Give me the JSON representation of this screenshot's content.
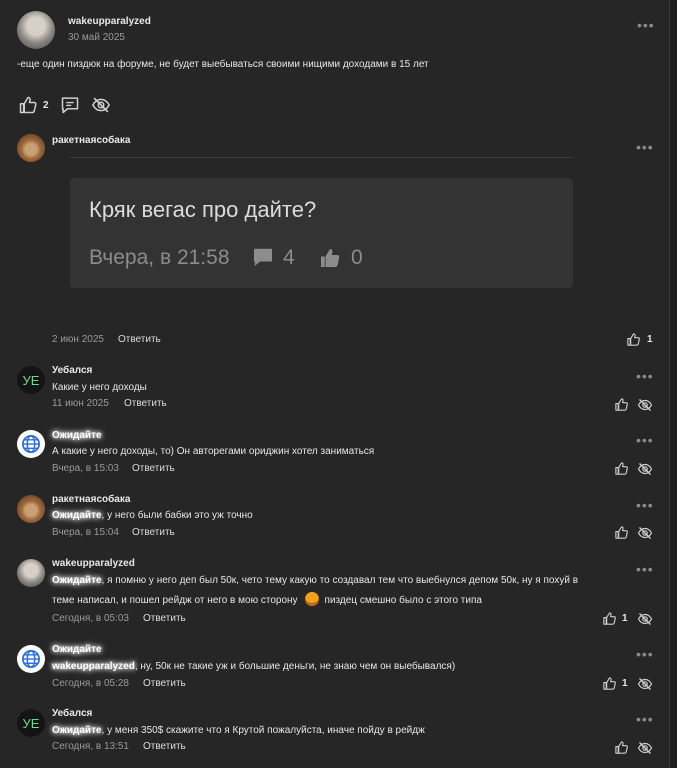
{
  "post": {
    "author": "wakeupparalyzed",
    "date": "30 май 2025",
    "text": "-еще один пиздюк на форуме, не будет выебываться своими нищими доходами в 15 лет",
    "likes": "2"
  },
  "comments": [
    {
      "author": "ракетнаясобака",
      "embed": {
        "title": "Кряк вегас про дайте?",
        "time": "Вчера, в 21:58",
        "comments": "4",
        "likes": "0"
      },
      "date": "2 июн 2025",
      "reply": "Ответить",
      "likes": "1"
    },
    {
      "author": "Уебался",
      "avatar_text": "УЕ",
      "text": "Какие у него доходы",
      "date": "11 июн 2025",
      "reply": "Ответить"
    },
    {
      "author": "Ожидайте",
      "text": "А какие у него доходы, то) Он авторегами ориджин хотел заниматься",
      "date": "Вчера, в 15:03",
      "reply": "Ответить"
    },
    {
      "author": "ракетнаясобака",
      "mention": "Ожидайте",
      "text": ", у него были бабки это уж точно",
      "date": "Вчера, в 15:04",
      "reply": "Ответить"
    },
    {
      "author": "wakeupparalyzed",
      "mention": "Ожидайте",
      "text_line1": ", я помню у него деп был 50к, чето тему какую то создавал тем что выебнулся депом 50к, ну я похуй в",
      "text_line2a": "теме написал, и пошел рейдж от него в мою сторону",
      "text_line2b": "пиздец смешно было с этого типа",
      "date": "Сегодня, в 05:03",
      "reply": "Ответить",
      "likes": "1"
    },
    {
      "author": "Ожидайте",
      "mention": "wakeupparalyzed",
      "text": ", ну, 50к не такие уж и большие деньги, не знаю чем он выебывался)",
      "date": "Сегодня, в 05:28",
      "reply": "Ответить",
      "likes": "1"
    },
    {
      "author": "Уебался",
      "avatar_text": "УЕ",
      "mention": "Ожидайте",
      "text": ", у меня 350$ скажите что я Крутой пожалуйста, иначе пойду в рейдж",
      "date": "Сегодня, в 13:51",
      "reply": "Ответить"
    }
  ],
  "icons": {
    "like": "thumbs-up-icon",
    "comment": "comment-icon",
    "hide": "eye-off-icon",
    "more": "more-dots-icon",
    "globe": "globe-icon"
  },
  "colors": {
    "background": "#262626",
    "card": "#333333",
    "accent_green": "#63e08a",
    "globe_blue": "#2a6fdb"
  }
}
